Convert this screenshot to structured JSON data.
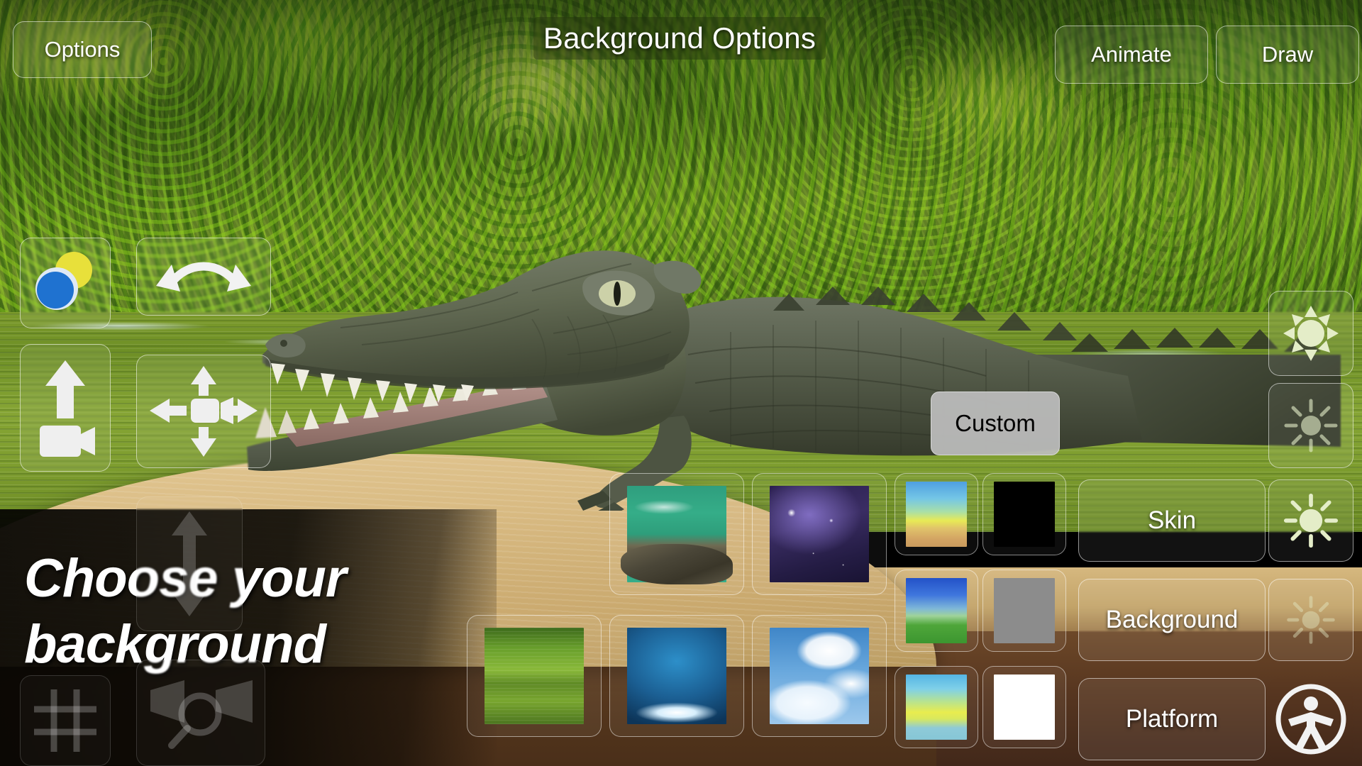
{
  "app": {
    "title": "Background Options",
    "caption_line1": "Choose your",
    "caption_line2": "background"
  },
  "topbar": {
    "options_label": "Options",
    "title_label": "Background Options",
    "animate_label": "Animate",
    "draw_label": "Draw"
  },
  "left_tools": [
    {
      "name": "color-wheel",
      "icon": "color-circles-icon",
      "tooltip": "Lighting color"
    },
    {
      "name": "rotate",
      "icon": "rotate-arc-arrow-icon",
      "tooltip": "Rotate camera"
    },
    {
      "name": "camera-up",
      "icon": "camera-up-arrow-icon",
      "tooltip": "Camera height"
    },
    {
      "name": "pan",
      "icon": "four-way-move-camera-icon",
      "tooltip": "Pan camera"
    },
    {
      "name": "vertical-move",
      "icon": "vertical-double-arrow-icon",
      "tooltip": "Move vertically"
    },
    {
      "name": "grid",
      "icon": "grid-icon",
      "tooltip": "Toggle grid"
    },
    {
      "name": "zoom",
      "icon": "magnifier-icon",
      "tooltip": "Zoom"
    }
  ],
  "right_panel": {
    "custom_label": "Custom",
    "skin_label": "Skin",
    "background_label": "Background",
    "platform_label": "Platform"
  },
  "brightness_controls": [
    {
      "name": "sun-bright",
      "icon": "sun-filled-icon",
      "level": "high"
    },
    {
      "name": "sun-medium",
      "icon": "sun-rays-icon",
      "level": "medium"
    },
    {
      "name": "sun-low",
      "icon": "sun-filled-icon",
      "level": "low"
    },
    {
      "name": "sun-dim",
      "icon": "sun-rays-icon",
      "level": "dim"
    },
    {
      "name": "accessibility",
      "icon": "accessibility-person-icon",
      "level": ""
    }
  ],
  "background_thumbnails": [
    {
      "id": "river",
      "label": "River rocks",
      "style": "sw-river",
      "size": "big"
    },
    {
      "id": "space",
      "label": "Outer space",
      "style": "sw-space",
      "size": "big"
    },
    {
      "id": "forest",
      "label": "Forest lake",
      "style": "sw-forest",
      "size": "big"
    },
    {
      "id": "studio",
      "label": "Blue studio",
      "style": "sw-studio",
      "size": "big"
    },
    {
      "id": "clouds",
      "label": "Clouds sky",
      "style": "sw-clouds",
      "size": "big"
    },
    {
      "id": "desert",
      "label": "Desert sky",
      "style": "sw-desert",
      "size": "sm"
    },
    {
      "id": "black",
      "label": "Black",
      "style": "sw-black",
      "size": "sm"
    },
    {
      "id": "field",
      "label": "Sky and field",
      "style": "sw-field",
      "size": "sm"
    },
    {
      "id": "gray",
      "label": "Gray",
      "style": "sw-gray",
      "size": "sm"
    },
    {
      "id": "lime",
      "label": "Lime sky",
      "style": "sw-lime",
      "size": "sm"
    },
    {
      "id": "white",
      "label": "White",
      "style": "sw-white",
      "size": "sm"
    }
  ],
  "scene": {
    "model": "crocodile",
    "environment": "river-forest",
    "platform": "wooden-disc"
  },
  "colors": {
    "hud_border": "#ffffff",
    "caption_text": "#ffffff",
    "custom_button_bg": "#bebebe",
    "custom_button_text": "#000000",
    "thumb_black": "#000000",
    "thumb_gray": "#8c8c8c",
    "thumb_white": "#ffffff"
  }
}
